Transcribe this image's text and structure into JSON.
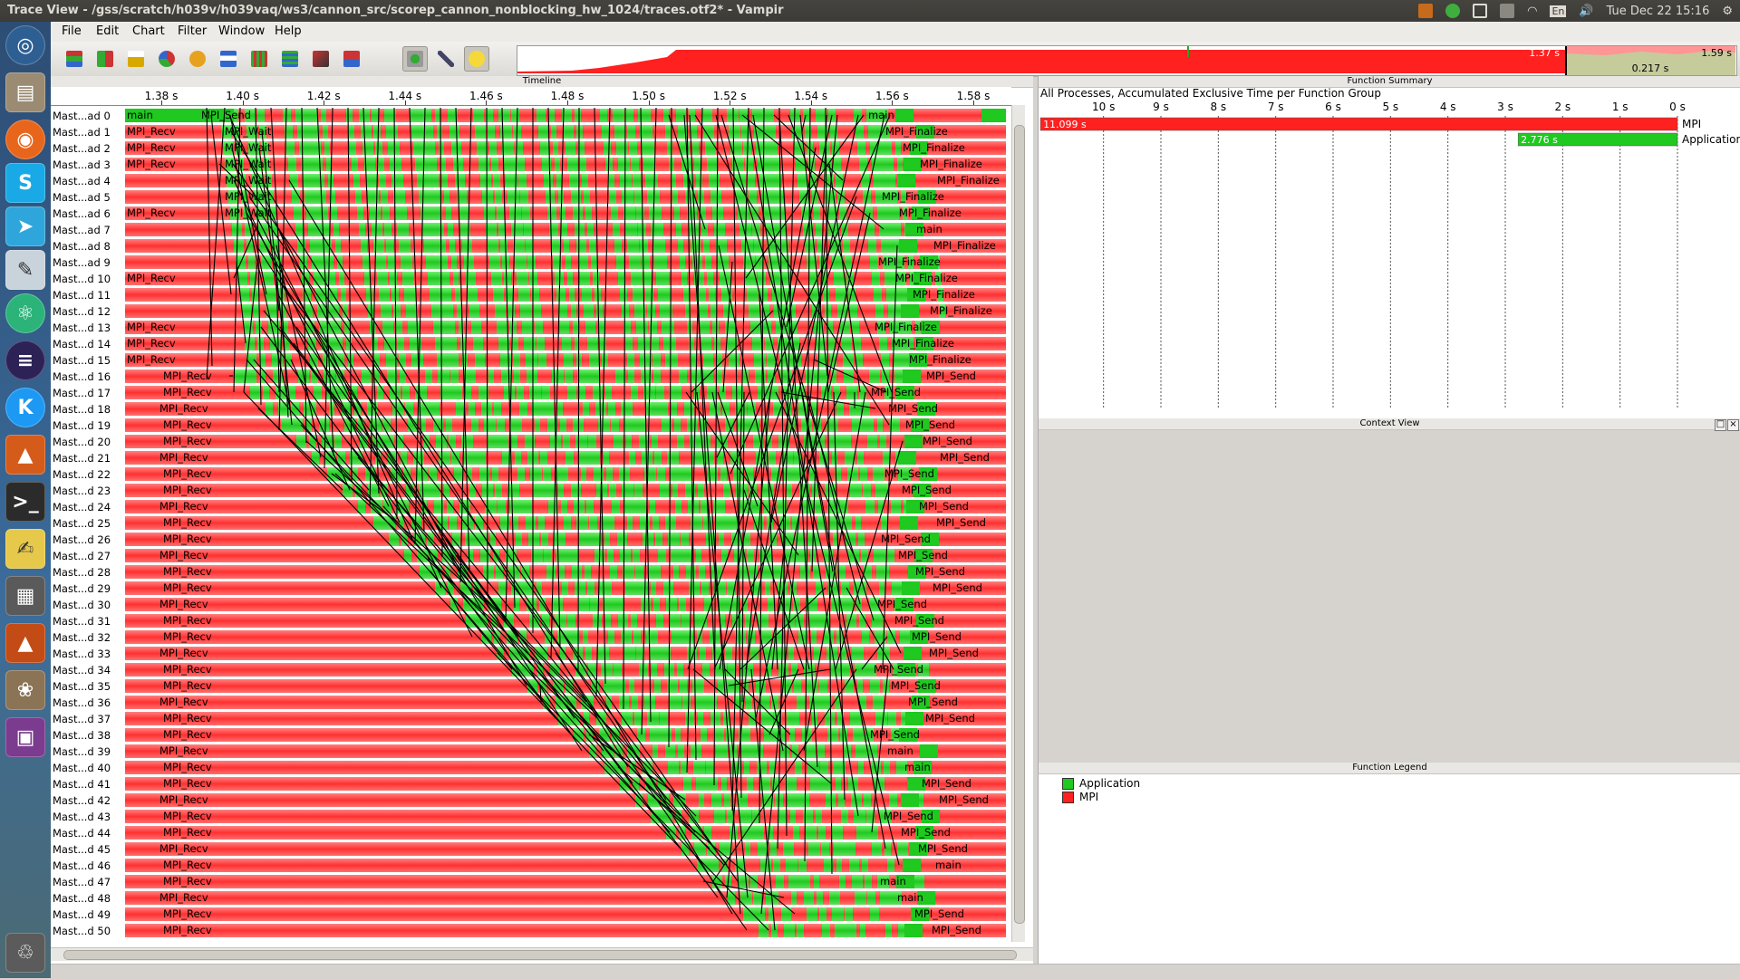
{
  "window": {
    "title": "Trace View - /gss/scratch/h039v/h039vaq/ws3/cannon_src/scorep_cannon_nonblocking_hw_1024/traces.otf2* - Vampir"
  },
  "tray": {
    "keyboard": "En",
    "clock": "Tue Dec 22 15:16"
  },
  "launcher": {
    "items": [
      "dash-icon",
      "files-icon",
      "firefox-icon",
      "skype-icon",
      "telegram-icon",
      "text-editor-icon",
      "atom-icon",
      "eclipse-icon",
      "kde-icon",
      "matlab-icon",
      "terminal-icon",
      "notes-icon",
      "calculator-icon",
      "matlab2-icon",
      "gimp-icon",
      "workspace-icon",
      "trash-icon"
    ]
  },
  "menu": [
    "File",
    "Edit",
    "Chart",
    "Filter",
    "Window",
    "Help"
  ],
  "toolbar": [
    "timeline-icon",
    "process-timeline-icon",
    "counter-icon",
    "summary-pie-icon",
    "function-summary-icon",
    "process-summary-icon",
    "message-matrix-icon",
    "io-icon",
    "call-tree-icon",
    "master-timeline-icon",
    "zoom-icon",
    "settings-icon",
    "hint-icon"
  ],
  "overview": {
    "selection_start": "1.37 s",
    "selection_end": "1.59 s",
    "selection_length": "0.217 s"
  },
  "timeline": {
    "title": "Timeline",
    "ticks": [
      "1.38 s",
      "1.40 s",
      "1.42 s",
      "1.44 s",
      "1.46 s",
      "1.48 s",
      "1.50 s",
      "1.52 s",
      "1.54 s",
      "1.56 s",
      "1.58 s"
    ],
    "processes": [
      "Mast...ad 0",
      "Mast...ad 1",
      "Mast...ad 2",
      "Mast...ad 3",
      "Mast...ad 4",
      "Mast...ad 5",
      "Mast...ad 6",
      "Mast...ad 7",
      "Mast...ad 8",
      "Mast...ad 9",
      "Mast...d 10",
      "Mast...d 11",
      "Mast...d 12",
      "Mast...d 13",
      "Mast...d 14",
      "Mast...d 15",
      "Mast...d 16",
      "Mast...d 17",
      "Mast...d 18",
      "Mast...d 19",
      "Mast...d 20",
      "Mast...d 21",
      "Mast...d 22",
      "Mast...d 23",
      "Mast...d 24",
      "Mast...d 25",
      "Mast...d 26",
      "Mast...d 27",
      "Mast...d 28",
      "Mast...d 29",
      "Mast...d 30",
      "Mast...d 31",
      "Mast...d 32",
      "Mast...d 33",
      "Mast...d 34",
      "Mast...d 35",
      "Mast...d 36",
      "Mast...d 37",
      "Mast...d 38",
      "Mast...d 39",
      "Mast...d 40",
      "Mast...d 41",
      "Mast...d 42",
      "Mast...d 43",
      "Mast...d 44",
      "Mast...d 45",
      "Mast...d 46",
      "Mast...d 47",
      "Mast...d 48",
      "Mast...d 49",
      "Mast...d 50"
    ],
    "left_labels": [
      "main",
      "MPI_Recv",
      "MPI_Recv",
      "MPI_Recv",
      "",
      "",
      "MPI_Recv",
      "",
      "",
      "",
      "MPI_Recv",
      "",
      "",
      "MPI_Recv",
      "MPI_Recv",
      "MPI_Recv",
      "MPI_Recv",
      "MPI_Recv",
      "MPI_Recv",
      "MPI_Recv",
      "MPI_Recv",
      "MPI_Recv",
      "MPI_Recv",
      "MPI_Recv",
      "MPI_Recv",
      "MPI_Recv",
      "MPI_Recv",
      "MPI_Recv",
      "MPI_Recv",
      "MPI_Recv",
      "MPI_Recv",
      "MPI_Recv",
      "MPI_Recv",
      "MPI_Recv",
      "MPI_Recv",
      "MPI_Recv",
      "MPI_Recv",
      "MPI_Recv",
      "MPI_Recv",
      "MPI_Recv",
      "MPI_Recv",
      "MPI_Recv",
      "MPI_Recv",
      "MPI_Recv",
      "MPI_Recv",
      "MPI_Recv",
      "MPI_Recv",
      "MPI_Recv",
      "MPI_Recv",
      "MPI_Recv",
      "MPI_Recv"
    ],
    "mid_labels": [
      "MPI_Send",
      "MPI_Wait",
      "MPI_Wait",
      "MPI_Wait",
      "MPI_Wait",
      "MPI_Wait",
      "MPI_Wait"
    ],
    "right_labels": [
      "main",
      "MPI_Finalize",
      "MPI_Finalize",
      "MPI_Finalize",
      "MPI_Finalize",
      "MPI_Finalize",
      "MPI_Finalize",
      "main",
      "MPI_Finalize",
      "MPI_Finalize",
      "MPI_Finalize",
      "MPI_Finalize",
      "MPI_Finalize",
      "MPI_Finalize",
      "MPI_Finalize",
      "MPI_Finalize",
      "MPI_Send",
      "MPI_Send",
      "MPI_Send",
      "MPI_Send",
      "MPI_Send",
      "MPI_Send",
      "MPI_Send",
      "MPI_Send",
      "MPI_Send",
      "MPI_Send",
      "MPI_Send",
      "MPI_Send",
      "MPI_Send",
      "MPI_Send",
      "MPI_Send",
      "MPI_Send",
      "MPI_Send",
      "MPI_Send",
      "MPI_Send",
      "MPI_Send",
      "MPI_Send",
      "MPI_Send",
      "MPI_Send",
      "main",
      "main",
      "MPI_Send",
      "MPI_Send",
      "MPI_Send",
      "MPI_Send",
      "MPI_Send",
      "main",
      "main",
      "main",
      "MPI_Send",
      "MPI_Send"
    ]
  },
  "function_summary": {
    "title": "Function Summary",
    "heading": "All Processes, Accumulated Exclusive Time per Function Group",
    "ticks": [
      "10 s",
      "9 s",
      "8 s",
      "7 s",
      "6 s",
      "5 s",
      "4 s",
      "3 s",
      "2 s",
      "1 s",
      "0 s"
    ]
  },
  "chart_data": {
    "type": "bar",
    "categories": [
      "MPI",
      "Application"
    ],
    "values": [
      11.099,
      2.776
    ],
    "value_labels": [
      "11.099 s",
      "2.776 s"
    ],
    "xlim": [
      11.1,
      0
    ],
    "colors": {
      "MPI": "#ff2020",
      "Application": "#1fc91f"
    }
  },
  "context_view": {
    "title": "Context View"
  },
  "function_legend": {
    "title": "Function Legend",
    "items": [
      {
        "name": "Application",
        "color": "#1fc91f"
      },
      {
        "name": "MPI",
        "color": "#ff2020"
      }
    ]
  }
}
